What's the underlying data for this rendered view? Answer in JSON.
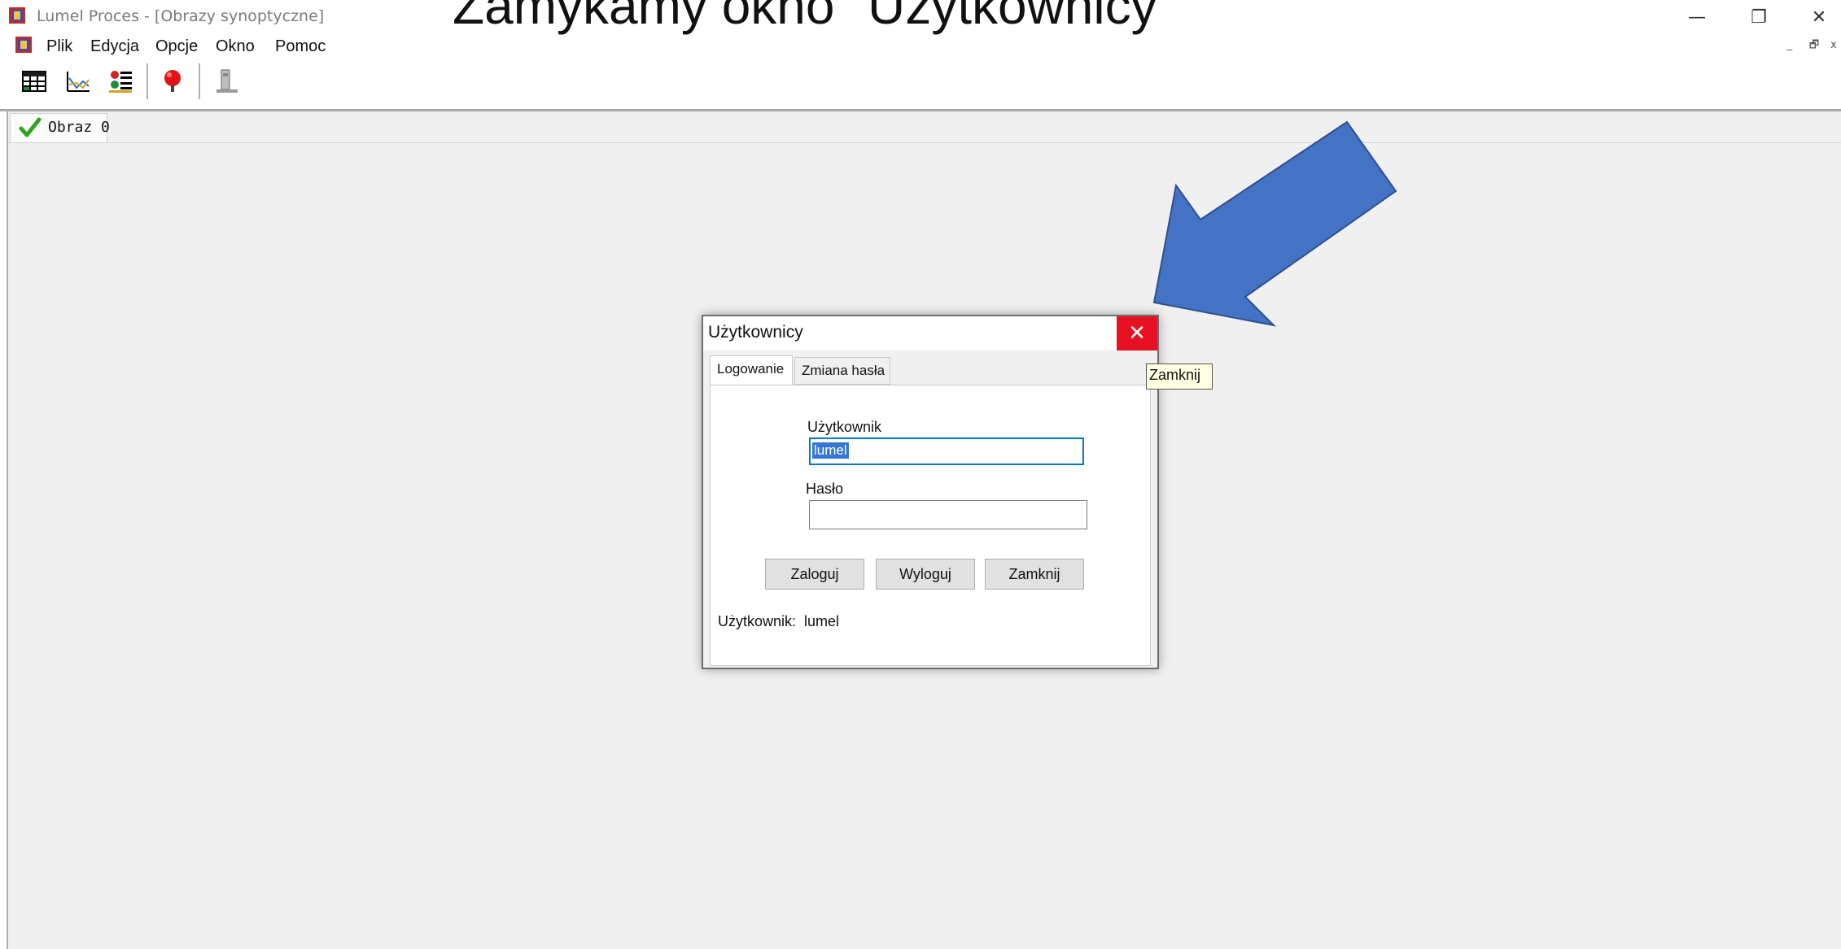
{
  "window": {
    "title": "Lumel Proces - [Obrazy synoptyczne]",
    "overlay_heading": "Zamykamy okno \"Użytkownicy\"",
    "controls": {
      "minimize": "—",
      "restore": "❐",
      "close": "✕"
    }
  },
  "menu": {
    "items": [
      "Plik",
      "Edycja",
      "Opcje",
      "Okno",
      "Pomoc"
    ],
    "mdi_controls": {
      "minimize": "_",
      "restore": "🗗",
      "close": "x"
    }
  },
  "toolbar": {
    "icons": [
      "table-icon",
      "chart-icon",
      "alarm-list-icon",
      "red-pin-icon",
      "device-icon"
    ]
  },
  "workspace": {
    "tabs": [
      {
        "label": "Obraz 0",
        "icon": "green-check-icon"
      }
    ]
  },
  "dialog": {
    "title": "Użytkownicy",
    "close_glyph": "✕",
    "tabs": [
      "Logowanie",
      "Zmiana hasła"
    ],
    "user_label": "Użytkownik",
    "user_value": "lumel",
    "password_label": "Hasło",
    "password_value": "",
    "buttons": {
      "login": "Zaloguj",
      "logout": "Wyloguj",
      "close": "Zamknij"
    },
    "status_label": "Użytkownik:",
    "status_value": "lumel"
  },
  "tooltip": {
    "text": "Zamknij"
  },
  "colors": {
    "arrow": "#4472c4",
    "close_button": "#e81123",
    "selection": "#3477d6",
    "focus_border": "#0078d7",
    "tooltip_bg": "#ffffe1"
  }
}
